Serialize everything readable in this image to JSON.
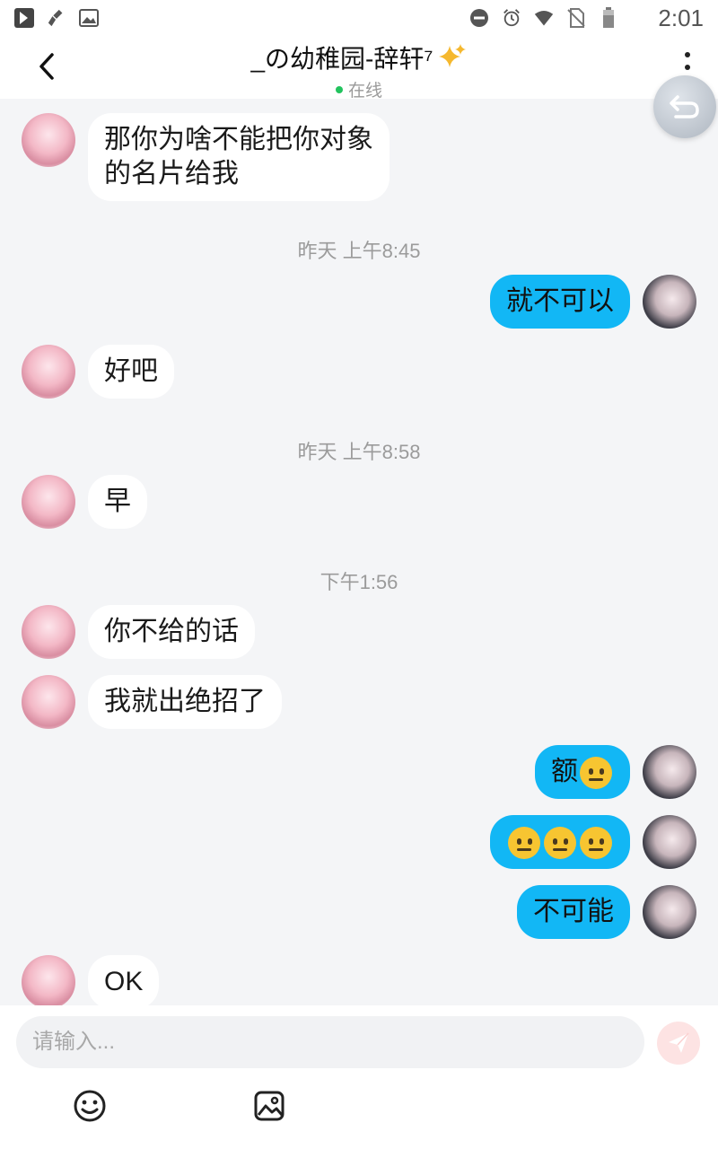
{
  "status_bar": {
    "time": "2:01",
    "left_icons": [
      "app-notification-icon",
      "cleaner-icon",
      "gallery-icon"
    ],
    "right_icons": [
      "do-not-disturb-icon",
      "alarm-icon",
      "wifi-icon",
      "no-sim-icon",
      "battery-icon"
    ]
  },
  "header": {
    "title": "_の幼稚园-辞轩⁷",
    "status": "在线",
    "status_color": "#22c35e"
  },
  "messages": [
    {
      "side": "them",
      "text": "那你为啥不能把你对象\n的名片给我"
    },
    {
      "type": "timestamp",
      "text": "昨天 上午8:45"
    },
    {
      "side": "me",
      "text": "就不可以"
    },
    {
      "side": "them",
      "text": "好吧"
    },
    {
      "type": "timestamp",
      "text": "昨天 上午8:58"
    },
    {
      "side": "them",
      "text": "早"
    },
    {
      "type": "timestamp",
      "text": "下午1:56"
    },
    {
      "side": "them",
      "text": "你不给的话"
    },
    {
      "side": "them",
      "text": "我就出绝招了"
    },
    {
      "side": "me",
      "text": "额",
      "emojis": 1
    },
    {
      "side": "me",
      "text": "",
      "emojis": 3
    },
    {
      "side": "me",
      "text": "不可能"
    },
    {
      "side": "them",
      "text": "OK"
    }
  ],
  "input": {
    "placeholder": "请输入..."
  },
  "colors": {
    "my_bubble": "#12b7f5",
    "their_bubble": "#ffffff",
    "background": "#f4f5f7"
  }
}
